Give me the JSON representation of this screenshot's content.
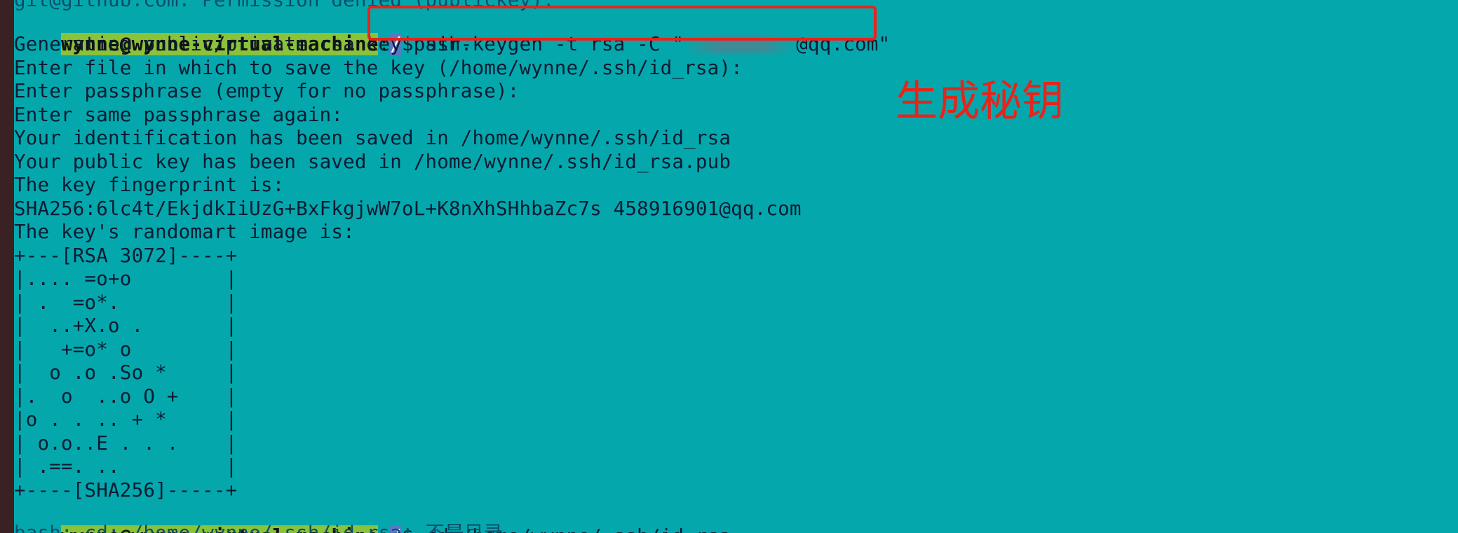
{
  "terminal": {
    "top_cut_line": "git@github.com: Permission denied (publickey).",
    "prompt": {
      "user": "wynne@wynne-virtual-machine",
      "sep": ":",
      "path": "/",
      "dollar": "$ "
    },
    "command1_prefix": "ssh-keygen -t rsa -C \"",
    "command1_suffix": "@qq.com\"",
    "output": [
      "Generating public/private rsa key pair.",
      "Enter file in which to save the key (/home/wynne/.ssh/id_rsa):",
      "Enter passphrase (empty for no passphrase):",
      "Enter same passphrase again:",
      "Your identification has been saved in /home/wynne/.ssh/id_rsa",
      "Your public key has been saved in /home/wynne/.ssh/id_rsa.pub",
      "The key fingerprint is:",
      "SHA256:6lc4t/EkjdkIiUzG+BxFkgjwW7oL+K8nXhSHhbaZc7s 458916901@qq.com",
      "The key's randomart image is:",
      "+---[RSA 3072]----+",
      "|.... =o+o        |",
      "| .  =o*.         |",
      "|  ..+X.o .       |",
      "|   +=o* o        |",
      "|  o .o .So *     |",
      "|.  o  ..o O +    |",
      "|o . . .. + *     |",
      "| o.o..E . . .    |",
      "| .==. ..         |",
      "+----[SHA256]-----+"
    ],
    "command2": "cd /home/wynne/.ssh/id_rsa",
    "bottom_cut_line": "bash: cd: /home/wynne/.ssh/id_rsa: 不是目录"
  },
  "annotation": {
    "text": "生成秘钥",
    "color": "#e8231a"
  },
  "colors": {
    "terminal_bg": "#04a8ac",
    "prompt_user_bg": "#8ac23a",
    "prompt_path_bg": "#5a78c8",
    "highlight": "#e8231a"
  }
}
